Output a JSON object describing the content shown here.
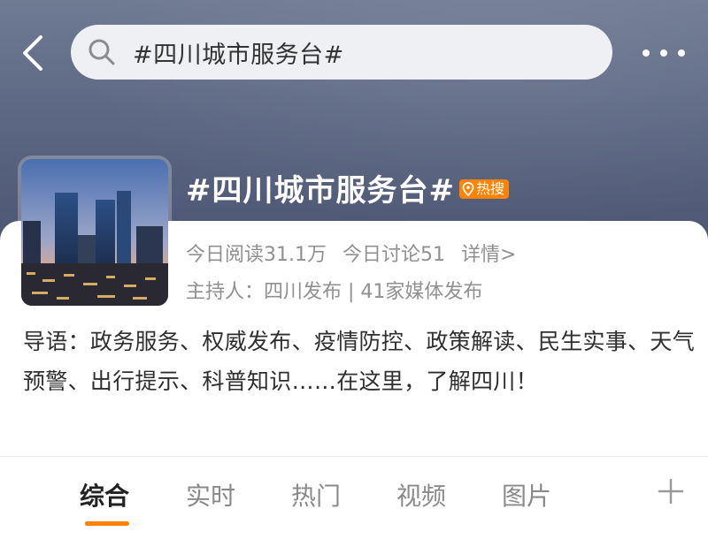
{
  "search": {
    "query": "#四川城市服务台#"
  },
  "topic": {
    "title": "#四川城市服务台#",
    "badge_label": "热搜",
    "reads": "今日阅读31.1万",
    "discussions": "今日讨论51",
    "detail_link": "详情>",
    "host": "主持人：四川发布 | 41家媒体发布",
    "intro": "导语：政务服务、权威发布、疫情防控、政策解读、民生实事、天气预警、出行提示、科普知识……在这里，了解四川！"
  },
  "tabs": [
    {
      "label": "综合",
      "active": true
    },
    {
      "label": "实时",
      "active": false
    },
    {
      "label": "热门",
      "active": false
    },
    {
      "label": "视频",
      "active": false
    },
    {
      "label": "图片",
      "active": false
    }
  ],
  "icons": {
    "back": "back-arrow-icon",
    "search": "search-icon",
    "more": "more-dots-icon",
    "badge": "location-pin-icon",
    "add": "plus-icon"
  },
  "colors": {
    "accent": "#ff8200",
    "header": "#5c6783",
    "muted_text": "#909090"
  }
}
